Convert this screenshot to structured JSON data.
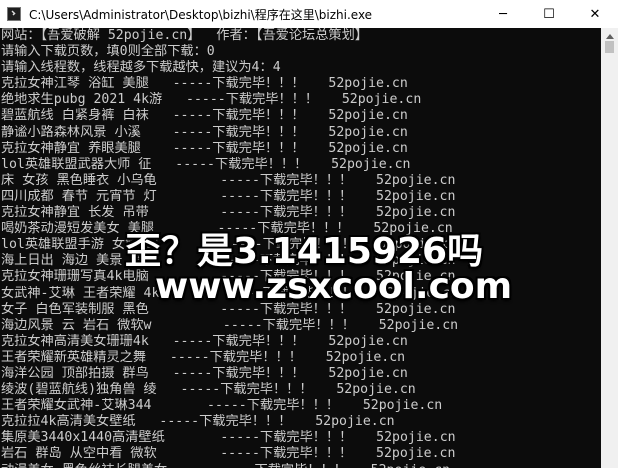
{
  "window": {
    "title": "C:\\Users\\Administrator\\Desktop\\bizhi\\程序在这里\\bizhi.exe",
    "controls": {
      "minimize": "─",
      "maximize": "☐",
      "close": "✕"
    },
    "icon": "console-app-icon"
  },
  "console": {
    "lines": [
      "网站：【吾爱破解 52pojie.cn】  作者：【吾爱论坛总策划】",
      "请输入下载页数，填0则全部下载：0",
      "请输入线程数，线程越多下载越快，建议为4：4",
      "克拉女神江琴 浴缸 美腿   -----下载完毕！！！   52pojie.cn",
      "绝地求生pubg 2021 4k游   -----下载完毕！！！   52pojie.cn",
      "碧蓝航线 白紧身裤 白袜   -----下载完毕！！！   52pojie.cn",
      "静谧小路森林风景 小溪    -----下载完毕！！！   52pojie.cn",
      "克拉女神静宜 养眼美腿    -----下载完毕！！！   52pojie.cn",
      "lol英雄联盟武器大师 征   -----下载完毕！！！   52pojie.cn",
      "床 女孩 黑色睡衣 小乌龟        -----下载完毕！！！   52pojie.cn",
      "四川成都 春节 元宵节 灯        -----下载完毕！！！   52pojie.cn",
      "克拉女神静宜 长发 吊带         -----下载完毕！！！   52pojie.cn",
      "喝奶茶动漫短发美女 美腿        -----下载完毕！！！   52pojie.cn",
      "lol英雄联盟手游 女警 凯        -----下载完毕！！！   52pojie.cn",
      "海上日出 海边 美景 清晨        -----下载完毕！！！   52pojie.cn",
      "克拉女神珊珊写真4k电脑         -----下载完毕！！！   52pojie.cn",
      "女武神-艾琳 王者荣耀 4k        -----下载完毕！！！   52pojie.cn",
      "女子 白色军装制服 黑色         -----下载完毕！！！   52pojie.cn",
      "海边风景 云 岩石 微软w         -----下载完毕！！！   52pojie.cn",
      "克拉女神高清美女珊珊4k   -----下载完毕！！！   52pojie.cn",
      "王者荣耀新英雄精灵之舞   -----下载完毕！！！   52pojie.cn",
      "海洋公园 顶部拍摄 群鸟   -----下载完毕！！！   52pojie.cn",
      "绫波(碧蓝航线)独角兽 绫   -----下载完毕！！！   52pojie.cn",
      "王者荣耀女武神-艾琳344       -----下载完毕！！！   52pojie.cn",
      "克拉拉4k高清美女壁纸   -----下载完毕！！！   52pojie.cn",
      "集原美3440x1440高清壁纸       -----下载完毕！！！   52pojie.cn",
      "岩石 群岛 从空中看 微软        -----下载完毕！！！   52pojie.cn",
      "动漫美女 黑色丝袜长腿美女      -----下载完毕！！！   52pojie.cn"
    ]
  },
  "watermark": {
    "line1": "歪？是3.1415926吗",
    "line2": "www.zsxcool.com"
  }
}
